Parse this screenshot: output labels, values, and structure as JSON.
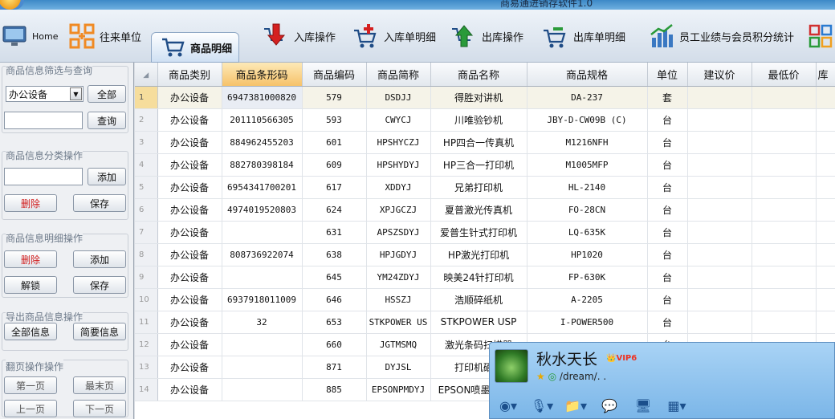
{
  "window": {
    "title": "商易通进销存软件1.0"
  },
  "toolbar": {
    "items": [
      {
        "label": "Home",
        "icon": "monitor-icon"
      },
      {
        "label": "往来单位",
        "icon": "network-icon"
      },
      {
        "label": "商品明细",
        "icon": "cart-icon",
        "active": true
      },
      {
        "label": "入库操作",
        "icon": "down-arrow-icon"
      },
      {
        "label": "入库单明细",
        "icon": "cart-add-icon"
      },
      {
        "label": "出库操作",
        "icon": "up-arrow-icon"
      },
      {
        "label": "出库单明细",
        "icon": "cart-remove-icon"
      },
      {
        "label": "员工业绩与会员积分统计",
        "icon": "bar-chart-icon"
      }
    ]
  },
  "sidebar": {
    "filter": {
      "title": "商品信息筛选与查询",
      "category": "办公设备",
      "all_label": "全部",
      "search_value": "",
      "search_label": "查询"
    },
    "category_ops": {
      "title": "商品信息分类操作",
      "input_value": "",
      "add_label": "添加",
      "delete_label": "删除",
      "save_label": "保存"
    },
    "detail_ops": {
      "title": "商品信息明细操作",
      "delete_label": "删除",
      "add_label": "添加",
      "unlock_label": "解锁",
      "save_label": "保存"
    },
    "export": {
      "title": "导出商品信息操作",
      "full_label": "全部信息",
      "brief_label": "简要信息"
    },
    "paging": {
      "title": "翻页操作操作",
      "first_label": "第一页",
      "last_label": "最末页",
      "prev_label": "上一页",
      "next_label": "下一页"
    }
  },
  "grid": {
    "columns": [
      "商品类别",
      "商品条形码",
      "商品编码",
      "商品简称",
      "商品名称",
      "商品规格",
      "单位",
      "建议价",
      "最低价",
      "库"
    ],
    "rows": [
      [
        "办公设备",
        "6947381000820",
        "579",
        "DSDJJ",
        "得胜对讲机",
        "DA-237",
        "套",
        "",
        ""
      ],
      [
        "办公设备",
        "201110566305",
        "593",
        "CWYCJ",
        "川唯验钞机",
        "JBY-D-CW09B (C)",
        "台",
        "",
        ""
      ],
      [
        "办公设备",
        "884962455203",
        "601",
        "HPSHYCZJ",
        "HP四合一传真机",
        "M1216NFH",
        "台",
        "",
        ""
      ],
      [
        "办公设备",
        "882780398184",
        "609",
        "HPSHYDYJ",
        "HP三合一打印机",
        "M1005MFP",
        "台",
        "",
        ""
      ],
      [
        "办公设备",
        "6954341700201",
        "617",
        "XDDYJ",
        "兄弟打印机",
        "HL-2140",
        "台",
        "",
        ""
      ],
      [
        "办公设备",
        "4974019520803",
        "624",
        "XPJGCZJ",
        "夏普激光传真机",
        "FO-28CN",
        "台",
        "",
        ""
      ],
      [
        "办公设备",
        "",
        "631",
        "APSZSDYJ",
        "爱普生针式打印机",
        "LQ-635K",
        "台",
        "",
        ""
      ],
      [
        "办公设备",
        "808736922074",
        "638",
        "HPJGDYJ",
        "HP激光打印机",
        "HP1020",
        "台",
        "",
        ""
      ],
      [
        "办公设备",
        "",
        "645",
        "YM24ZDYJ",
        "映美24针打印机",
        "FP-630K",
        "台",
        "",
        ""
      ],
      [
        "办公设备",
        "6937918011009",
        "646",
        "HSSZJ",
        "浩顺碎纸机",
        "A-2205",
        "台",
        "",
        ""
      ],
      [
        "办公设备",
        "32",
        "653",
        "STKPOWER US",
        "STKPOWER USP",
        "I-POWER500",
        "台",
        "",
        ""
      ],
      [
        "办公设备",
        "",
        "660",
        "JGTMSMQ",
        "激光条码扫描器",
        "",
        "台",
        "",
        ""
      ],
      [
        "办公设备",
        "",
        "871",
        "DYJSL",
        "打印机硒鼓",
        "",
        "",
        "",
        ""
      ],
      [
        "办公设备",
        "",
        "885",
        "EPSONPMDYJ",
        "EPSON喷墨打印机",
        "",
        "",
        "",
        ""
      ]
    ]
  },
  "qq_popup": {
    "nickname": "秋水天长",
    "vip": "VIP6",
    "signature": "/dream/. ."
  },
  "colors": {
    "header_sorted": "#f6c26a",
    "selected_row": "#f6dd9c",
    "toolbar_bg": "#dde6f0"
  }
}
